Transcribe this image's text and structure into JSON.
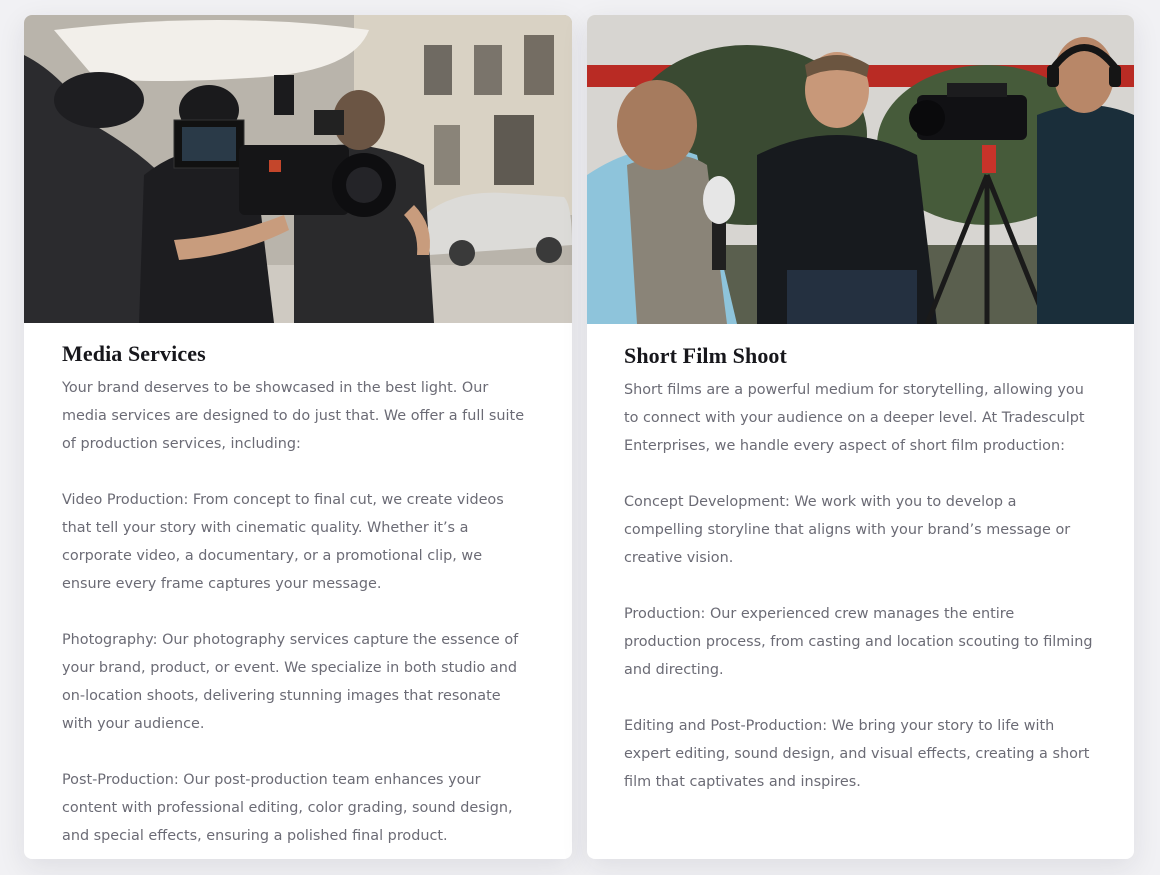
{
  "cards": [
    {
      "image_alt": "Film crew operating a cinema camera on a city street",
      "title": "Media Services",
      "paragraphs": [
        "Your brand deserves to be showcased in the best light. Our media services are designed to do just that. We offer a full suite of production services, including:",
        "Video Production: From concept to final cut, we create videos that tell your story with cinematic quality. Whether it’s a corporate video, a documentary, or a promotional clip, we ensure every frame captures your message.",
        "Photography: Our photography services capture the essence of your brand, product, or event. We specialize in both studio and on-location shoots, delivering stunning images that resonate with your audience.",
        "Post-Production: Our post-production team enhances your content with professional editing, color grading, sound design, and special effects, ensuring a polished final product."
      ]
    },
    {
      "image_alt": "Interview being filmed outdoors with a camera on a tripod",
      "title": "Short Film Shoot",
      "paragraphs": [
        "Short films are a powerful medium for storytelling, allowing you to connect with your audience on a deeper level. At Tradesculpt Enterprises, we handle every aspect of short film production:",
        "Concept Development: We work with you to develop a compelling storyline that aligns with your brand’s message or creative vision.",
        "Production: Our experienced crew manages the entire production process, from casting and location scouting to filming and directing.",
        "Editing and Post-Production: We bring your story to life with expert editing, sound design, and visual effects, creating a short film that captivates and inspires."
      ]
    }
  ]
}
